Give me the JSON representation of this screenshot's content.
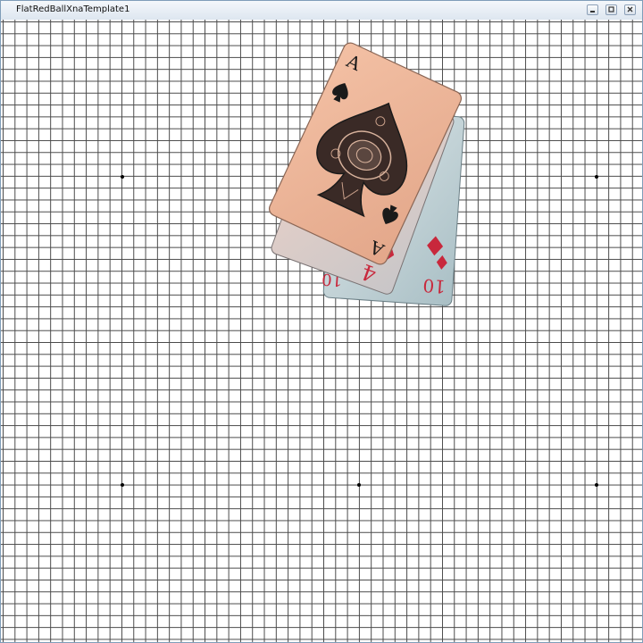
{
  "window": {
    "title": "FlatRedBallXnaTemplate1",
    "controls": [
      "minimize-icon",
      "maximize-icon",
      "close-icon"
    ]
  },
  "cards": [
    {
      "rank": "10",
      "suit": "diamonds"
    },
    {
      "rank": "4",
      "suit": "diamonds"
    },
    {
      "rank": "A",
      "suit": "spades"
    }
  ],
  "colors": {
    "grid_line": "#4a4a4a",
    "card_front": "#ecb396",
    "card_back_tint": "#b9c9cf",
    "diamond_red": "#c8283c",
    "spade_black": "#1a1a1a"
  }
}
